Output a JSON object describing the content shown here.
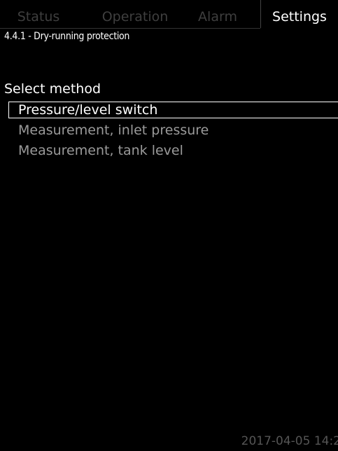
{
  "tabs": [
    {
      "label": "Status"
    },
    {
      "label": "Operation"
    },
    {
      "label": "Alarm"
    },
    {
      "label": "Settings"
    }
  ],
  "breadcrumb": "4.4.1 - Dry-running protection",
  "section": {
    "label": "Select method"
  },
  "options": [
    {
      "label": "Pressure/level switch",
      "selected": true
    },
    {
      "label": "Measurement, inlet pressure",
      "selected": false
    },
    {
      "label": "Measurement, tank level",
      "selected": false
    }
  ],
  "footer": {
    "timestamp": "2017-04-05 14:2"
  },
  "colors": {
    "background": "#000000",
    "active_text": "#ffffff",
    "inactive_tab": "#3f3f3f",
    "inactive_option": "#9a9a9a",
    "timestamp": "#555555"
  }
}
